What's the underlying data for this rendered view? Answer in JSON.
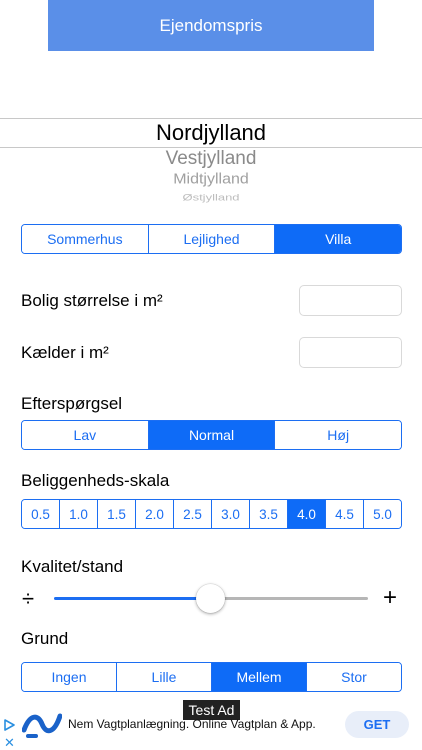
{
  "header": {
    "title": "Ejendomspris"
  },
  "region_picker": {
    "options": [
      "Nordjylland",
      "Vestjylland",
      "Midtjylland",
      "Østjylland"
    ],
    "selected": "Nordjylland"
  },
  "property_type": {
    "options": [
      "Sommerhus",
      "Lejlighed",
      "Villa"
    ],
    "selected": "Villa"
  },
  "size": {
    "label": "Bolig størrelse i m²",
    "value": ""
  },
  "basement": {
    "label": "Kælder i m²",
    "value": ""
  },
  "demand": {
    "label": "Efterspørgsel",
    "options": [
      "Lav",
      "Normal",
      "Høj"
    ],
    "selected": "Normal"
  },
  "location_scale": {
    "label": "Beliggenheds-skala",
    "options": [
      "0.5",
      "1.0",
      "1.5",
      "2.0",
      "2.5",
      "3.0",
      "3.5",
      "4.0",
      "4.5",
      "5.0"
    ],
    "selected": "4.0"
  },
  "quality": {
    "label": "Kvalitet/stand",
    "min_symbol": "÷",
    "max_symbol": "+",
    "value_fraction": 0.5
  },
  "plot": {
    "label": "Grund",
    "options": [
      "Ingen",
      "Lille",
      "Mellem",
      "Stor"
    ],
    "selected": "Mellem"
  },
  "ad": {
    "badge": "Test Ad",
    "text": "Nem Vagtplanlægning. Online Vagtplan & App.",
    "cta": "GET",
    "close_symbol": "✕"
  },
  "colors": {
    "accent": "#0e6bf7",
    "title_bar": "#5a8fe8"
  }
}
